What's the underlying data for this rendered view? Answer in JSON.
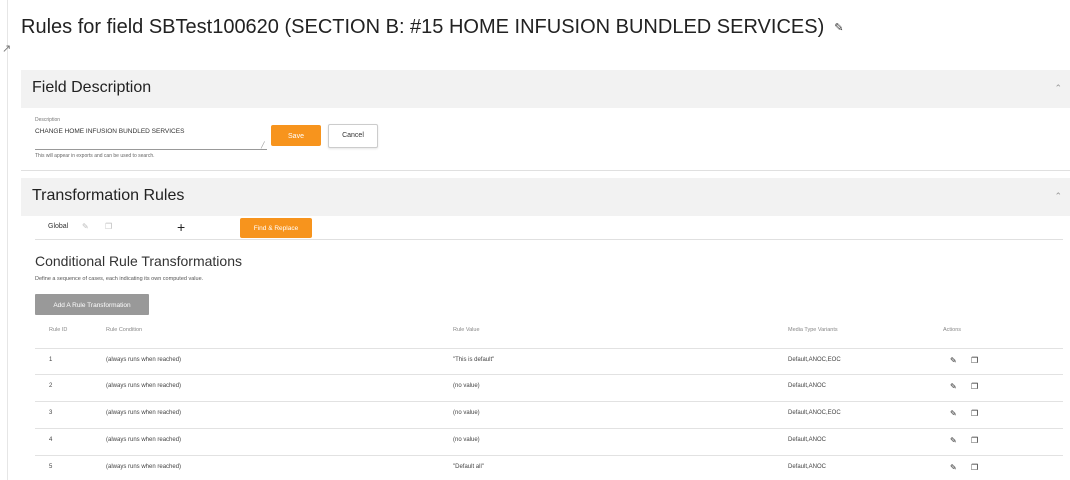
{
  "page": {
    "title": "Rules for field SBTest100620 (SECTION B: #15 HOME INFUSION BUNDLED SERVICES)",
    "title_icon": "edit-icon"
  },
  "field_description": {
    "header": "Field Description",
    "input_label": "Description",
    "input_value": "CHANGE HOME INFUSION BUNDLED SERVICES",
    "hint": "This will appear in exports and can be used to search.",
    "save_label": "Save",
    "cancel_label": "Cancel",
    "collapse_icon": "chevron-up-icon"
  },
  "transformation_rules": {
    "header": "Transformation Rules",
    "collapse_icon": "chevron-up-icon",
    "tabs": [
      {
        "label": "Global",
        "icons": [
          "edit-icon",
          "copy-icon"
        ]
      }
    ],
    "add_tab_label": "+",
    "find_replace_label": "Find & Replace",
    "section_title": "Conditional Rule Transformations",
    "section_subtitle": "Define a sequence of cases, each indicating its own computed value.",
    "add_rule_label": "Add A Rule Transformation",
    "columns": [
      "Rule ID",
      "Rule Condition",
      "Rule Value",
      "Media Type Variants",
      "Actions"
    ],
    "rows": [
      {
        "id": "1",
        "condition": "(always runs when reached)",
        "value": "\"This is default\"",
        "variants": "Default,ANOC,EOC"
      },
      {
        "id": "2",
        "condition": "(always runs when reached)",
        "value": "(no value)",
        "variants": "Default,ANOC"
      },
      {
        "id": "3",
        "condition": "(always runs when reached)",
        "value": "(no value)",
        "variants": "Default,ANOC,EOC"
      },
      {
        "id": "4",
        "condition": "(always runs when reached)",
        "value": "(no value)",
        "variants": "Default,ANOC"
      },
      {
        "id": "5",
        "condition": "(always runs when reached)",
        "value": "\"Default all\"",
        "variants": "Default,ANOC"
      }
    ],
    "row_action_icons": [
      "edit-icon",
      "copy-icon"
    ]
  },
  "colors": {
    "accent": "#f7941d",
    "header_bg": "#f2f2f2",
    "disabled_button": "#999999"
  }
}
